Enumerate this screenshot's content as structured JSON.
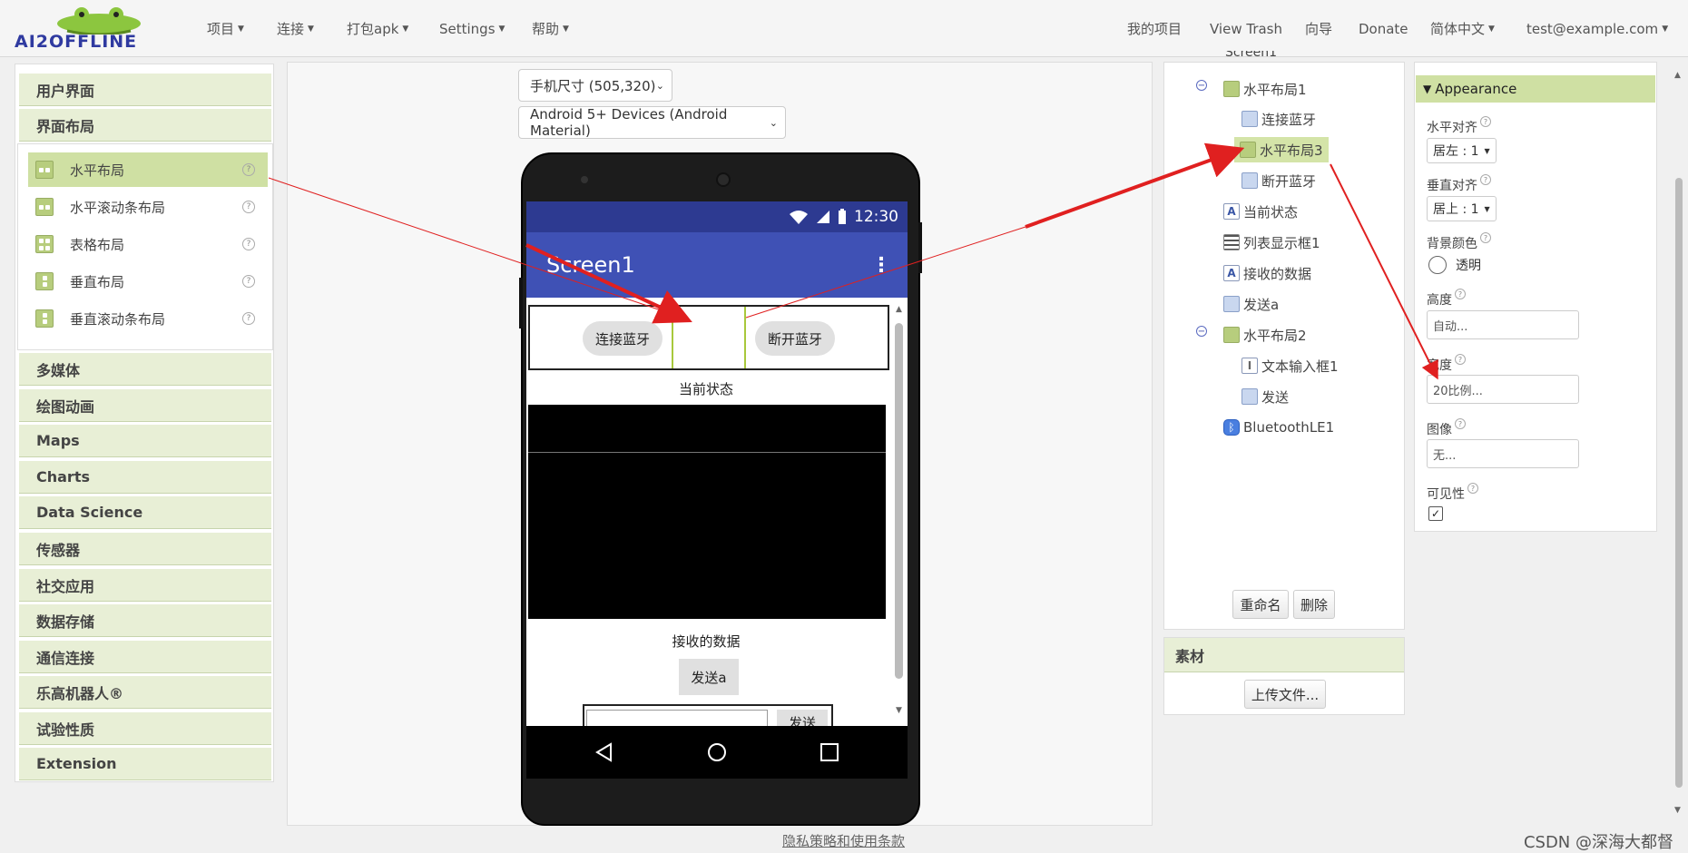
{
  "app": {
    "logo_text": "AI2OFFLINE"
  },
  "topnav": {
    "left": [
      {
        "label": "项目"
      },
      {
        "label": "连接"
      },
      {
        "label": "打包apk"
      },
      {
        "label": "Settings"
      },
      {
        "label": "帮助"
      }
    ],
    "right": {
      "my_projects": "我的项目",
      "view_trash": "View Trash",
      "guide": "向导",
      "donate": "Donate",
      "language": "简体中文",
      "account": "test@example.com"
    }
  },
  "palette": {
    "categories_top": [
      "用户界面",
      "界面布局"
    ],
    "layout_items": [
      "水平布局",
      "水平滚动条布局",
      "表格布局",
      "垂直布局",
      "垂直滚动条布局"
    ],
    "categories_bottom": [
      "多媒体",
      "绘图动画",
      "Maps",
      "Charts",
      "Data Science",
      "传感器",
      "社交应用",
      "数据存储",
      "通信连接",
      "乐高机器人®",
      "试验性质",
      "Extension"
    ]
  },
  "viewer": {
    "size_select": "手机尺寸 (505,320)",
    "theme_select": "Android 5+ Devices (Android Material)",
    "status_time": "12:30",
    "screen_title": "Screen1",
    "btn_connect": "连接蓝牙",
    "btn_disconnect": "断开蓝牙",
    "label_status": "当前状态",
    "label_received": "接收的数据",
    "btn_send_a": "发送a",
    "btn_send": "发送"
  },
  "components": {
    "root": "Screen1",
    "tree": [
      "水平布局1",
      "连接蓝牙",
      "水平布局3",
      "断开蓝牙",
      "当前状态",
      "列表显示框1",
      "接收的数据",
      "发送a",
      "水平布局2",
      "文本输入框1",
      "发送",
      "BluetoothLE1"
    ],
    "rename": "重命名",
    "delete": "删除",
    "media_header": "素材",
    "upload": "上传文件..."
  },
  "properties": {
    "section": "Appearance",
    "halign_label": "水平对齐",
    "halign_value": "居左 : 1",
    "valign_label": "垂直对齐",
    "valign_value": "居上 : 1",
    "bg_label": "背景颜色",
    "bg_value": "透明",
    "height_label": "高度",
    "height_value": "自动...",
    "width_label": "宽度",
    "width_value": "20比例...",
    "image_label": "图像",
    "image_value": "无...",
    "visible_label": "可见性"
  },
  "footer": {
    "privacy": "隐私策略和使用条款",
    "watermark": "CSDN @深海大都督"
  }
}
